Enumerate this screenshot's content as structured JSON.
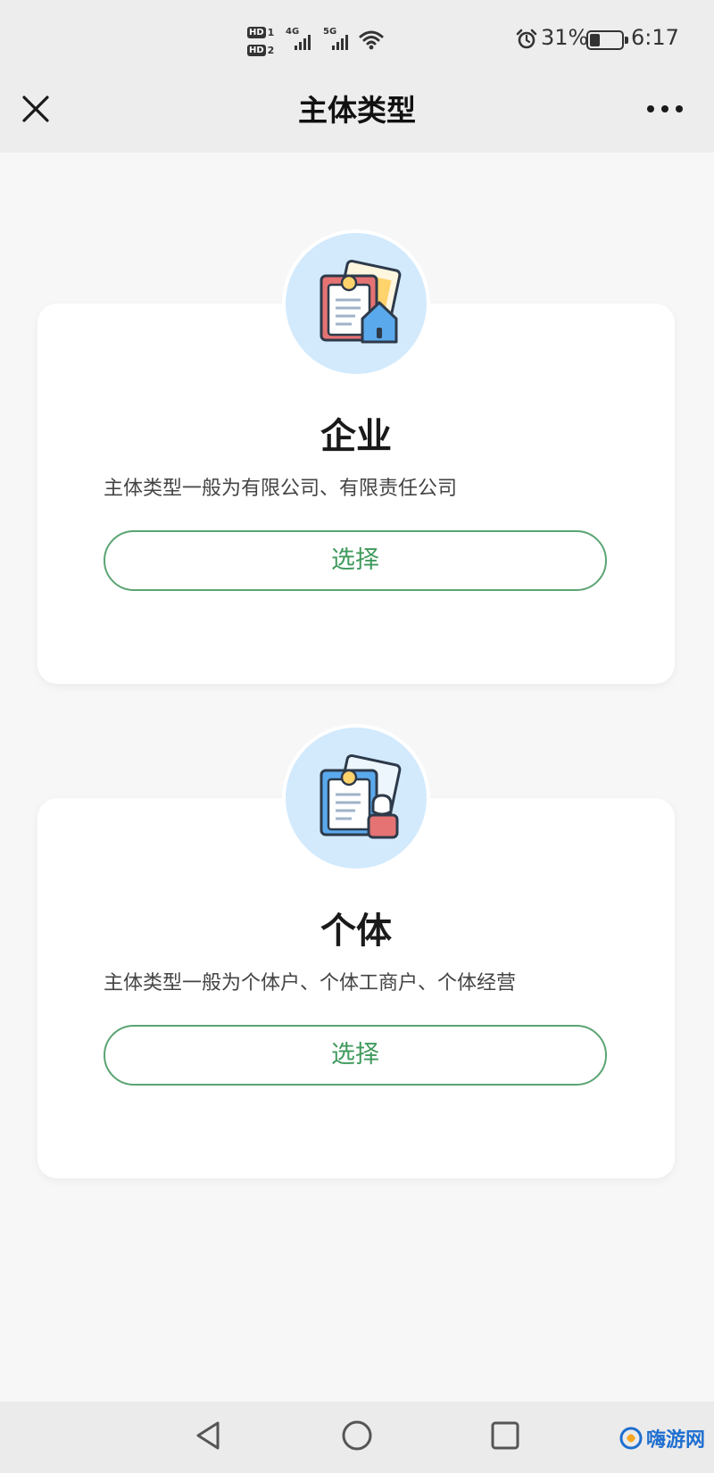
{
  "status_bar": {
    "sim1_tag": "HD",
    "sim1_num": "1",
    "sim2_tag": "HD",
    "sim2_num": "2",
    "net1": "4G",
    "net2": "5G",
    "battery_percent": "31%",
    "battery_level": 0.31,
    "time": "6:17",
    "icons": [
      "signal-icon",
      "wifi-icon",
      "alarm-icon",
      "battery-icon"
    ]
  },
  "header": {
    "title": "主体类型",
    "close_icon": "close-icon",
    "more_icon": "more-icon"
  },
  "options": [
    {
      "title": "企业",
      "description": "主体类型一般为有限公司、有限责任公司",
      "button_label": "选择",
      "icon": "enterprise-icon"
    },
    {
      "title": "个体",
      "description": "主体类型一般为个体户、个体工商户、个体经营",
      "button_label": "选择",
      "icon": "individual-icon"
    }
  ],
  "colors": {
    "accent_green": "#3f9a5c",
    "icon_circle": "#d3eafd",
    "header_bg": "#ededed",
    "page_bg": "#f7f7f7"
  },
  "system_nav": {
    "icons": [
      "back-icon",
      "home-icon",
      "recent-apps-icon"
    ]
  },
  "watermark": {
    "text": "嗨游网"
  }
}
